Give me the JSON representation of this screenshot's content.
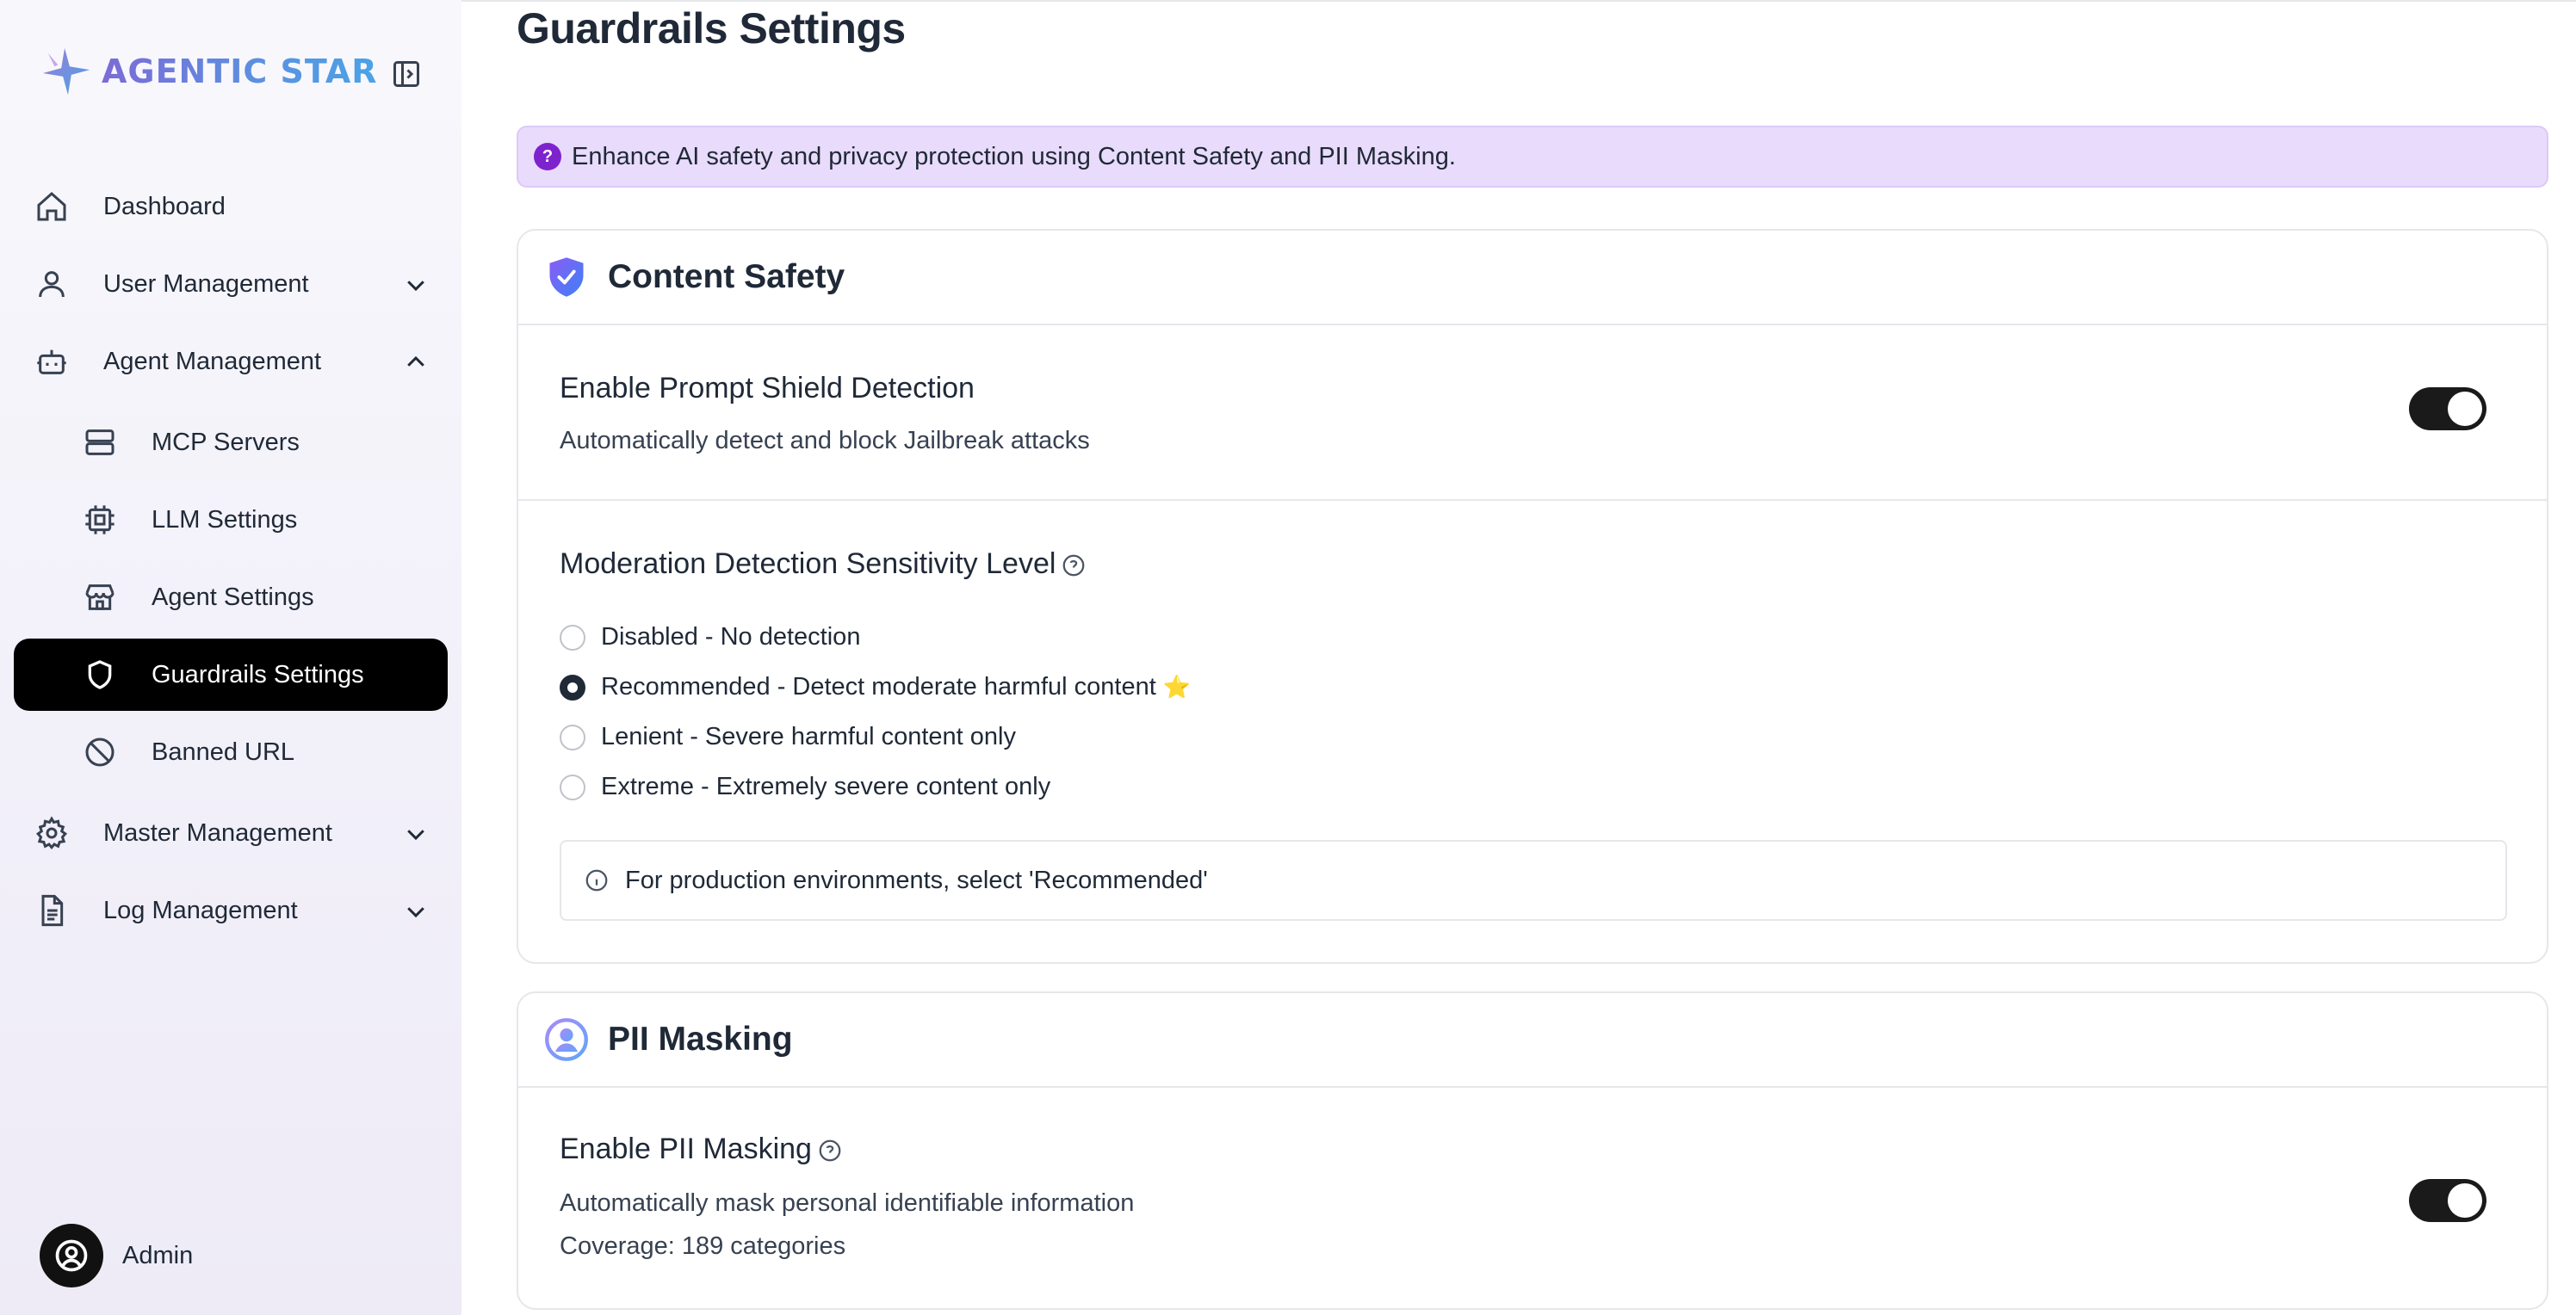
{
  "brand": {
    "name": "AGENTIC STAR"
  },
  "sidebar": {
    "items": [
      {
        "label": "Dashboard",
        "icon": "home-icon"
      },
      {
        "label": "User Management",
        "icon": "user-icon",
        "expanded": false
      },
      {
        "label": "Agent Management",
        "icon": "robot-icon",
        "expanded": true
      },
      {
        "label": "MCP Servers",
        "icon": "server-icon"
      },
      {
        "label": "LLM Settings",
        "icon": "cpu-icon"
      },
      {
        "label": "Agent Settings",
        "icon": "store-icon"
      },
      {
        "label": "Guardrails Settings",
        "icon": "shield-icon",
        "active": true
      },
      {
        "label": "Banned URL",
        "icon": "ban-icon"
      },
      {
        "label": "Master Management",
        "icon": "gear-icon",
        "expanded": false
      },
      {
        "label": "Log Management",
        "icon": "document-icon",
        "expanded": false
      }
    ],
    "user": {
      "name": "Admin"
    }
  },
  "page": {
    "title": "Guardrails Settings",
    "banner": "Enhance AI safety and privacy protection using Content Safety and PII Masking."
  },
  "content_safety": {
    "title": "Content Safety",
    "prompt_shield": {
      "title": "Enable Prompt Shield Detection",
      "description": "Automatically detect and block Jailbreak attacks",
      "enabled": true
    },
    "moderation": {
      "title": "Moderation Detection Sensitivity Level",
      "options": [
        {
          "label": "Disabled - No detection",
          "selected": false
        },
        {
          "label": "Recommended - Detect moderate harmful content",
          "selected": true,
          "badge": "⭐"
        },
        {
          "label": "Lenient - Severe harmful content only",
          "selected": false
        },
        {
          "label": "Extreme - Extremely severe content only",
          "selected": false
        }
      ],
      "note": "For production environments, select 'Recommended'"
    }
  },
  "pii_masking": {
    "title": "PII Masking",
    "enable": {
      "title": "Enable PII Masking",
      "description": "Automatically mask personal identifiable information",
      "coverage": "Coverage: 189 categories",
      "enabled": true
    }
  },
  "colors": {
    "accent": "#000000",
    "banner_bg": "#e9dbfb",
    "banner_icon": "#7e22ce",
    "toggle_on": "#1a1a1a"
  }
}
